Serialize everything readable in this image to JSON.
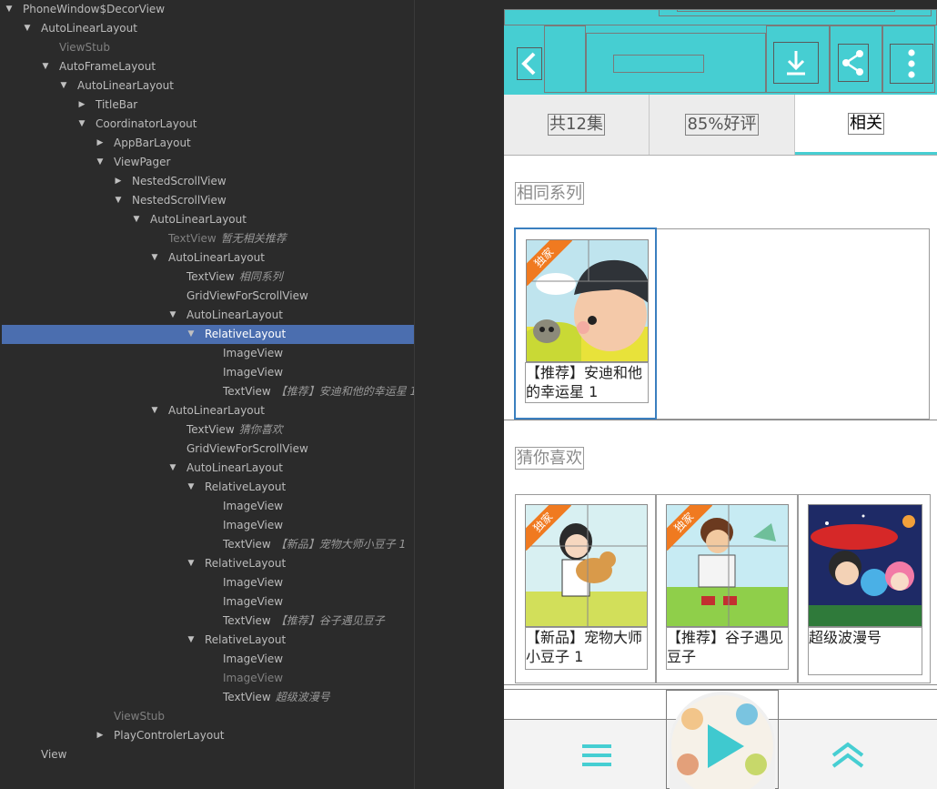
{
  "tree": {
    "rows": [
      {
        "label": "PhoneWindow$DecorView",
        "extra": "",
        "arrow": "▼"
      },
      {
        "label": "AutoLinearLayout",
        "extra": "",
        "arrow": "▼"
      },
      {
        "label": "ViewStub",
        "extra": "",
        "arrow": ""
      },
      {
        "label": "AutoFrameLayout",
        "extra": "",
        "arrow": "▼"
      },
      {
        "label": "AutoLinearLayout",
        "extra": "",
        "arrow": "▼"
      },
      {
        "label": "TitleBar",
        "extra": "",
        "arrow": "▶"
      },
      {
        "label": "CoordinatorLayout",
        "extra": "",
        "arrow": "▼"
      },
      {
        "label": "AppBarLayout",
        "extra": "",
        "arrow": "▶"
      },
      {
        "label": "ViewPager",
        "extra": "",
        "arrow": "▼"
      },
      {
        "label": "NestedScrollView",
        "extra": "",
        "arrow": "▶"
      },
      {
        "label": "NestedScrollView",
        "extra": "",
        "arrow": "▼"
      },
      {
        "label": "AutoLinearLayout",
        "extra": "",
        "arrow": "▼"
      },
      {
        "label": "TextView",
        "extra": "暂无相关推荐",
        "arrow": ""
      },
      {
        "label": "AutoLinearLayout",
        "extra": "",
        "arrow": "▼"
      },
      {
        "label": "TextView",
        "extra": "相同系列",
        "arrow": ""
      },
      {
        "label": "GridViewForScrollView",
        "extra": "",
        "arrow": ""
      },
      {
        "label": "AutoLinearLayout",
        "extra": "",
        "arrow": "▼"
      },
      {
        "label": "RelativeLayout",
        "extra": "",
        "arrow": "▼"
      },
      {
        "label": "ImageView",
        "extra": "",
        "arrow": ""
      },
      {
        "label": "ImageView",
        "extra": "",
        "arrow": ""
      },
      {
        "label": "TextView",
        "extra": "【推荐】安迪和他的幸运星 1",
        "arrow": ""
      },
      {
        "label": "AutoLinearLayout",
        "extra": "",
        "arrow": "▼"
      },
      {
        "label": "TextView",
        "extra": "猜你喜欢",
        "arrow": ""
      },
      {
        "label": "GridViewForScrollView",
        "extra": "",
        "arrow": ""
      },
      {
        "label": "AutoLinearLayout",
        "extra": "",
        "arrow": "▼"
      },
      {
        "label": "RelativeLayout",
        "extra": "",
        "arrow": "▼"
      },
      {
        "label": "ImageView",
        "extra": "",
        "arrow": ""
      },
      {
        "label": "ImageView",
        "extra": "",
        "arrow": ""
      },
      {
        "label": "TextView",
        "extra": "【新品】宠物大师小豆子 1",
        "arrow": ""
      },
      {
        "label": "RelativeLayout",
        "extra": "",
        "arrow": "▼"
      },
      {
        "label": "ImageView",
        "extra": "",
        "arrow": ""
      },
      {
        "label": "ImageView",
        "extra": "",
        "arrow": ""
      },
      {
        "label": "TextView",
        "extra": "【推荐】谷子遇见豆子",
        "arrow": ""
      },
      {
        "label": "RelativeLayout",
        "extra": "",
        "arrow": "▼"
      },
      {
        "label": "ImageView",
        "extra": "",
        "arrow": ""
      },
      {
        "label": "ImageView",
        "extra": "",
        "arrow": ""
      },
      {
        "label": "TextView",
        "extra": "超级波漫号",
        "arrow": ""
      },
      {
        "label": "ViewStub",
        "extra": "",
        "arrow": ""
      },
      {
        "label": "PlayControlerLayout",
        "extra": "",
        "arrow": "▶"
      },
      {
        "label": "View",
        "extra": "",
        "arrow": ""
      }
    ]
  },
  "phone": {
    "tabs": [
      "共12集",
      "85%好评",
      "相关"
    ],
    "section_same_series": "相同系列",
    "section_guess": "猜你喜欢",
    "ribbon_text": "独家",
    "same_series_cards": [
      {
        "title": "【推荐】安迪和他的幸运星 1"
      }
    ],
    "guess_cards": [
      {
        "title": "【新品】宠物大师小豆子 1"
      },
      {
        "title": "【推荐】谷子遇见豆子"
      },
      {
        "title": "超级波漫号"
      }
    ],
    "colors": {
      "accent": "#46ced2",
      "ribbon": "#f07a20",
      "selected": "#4b6eaf"
    }
  }
}
